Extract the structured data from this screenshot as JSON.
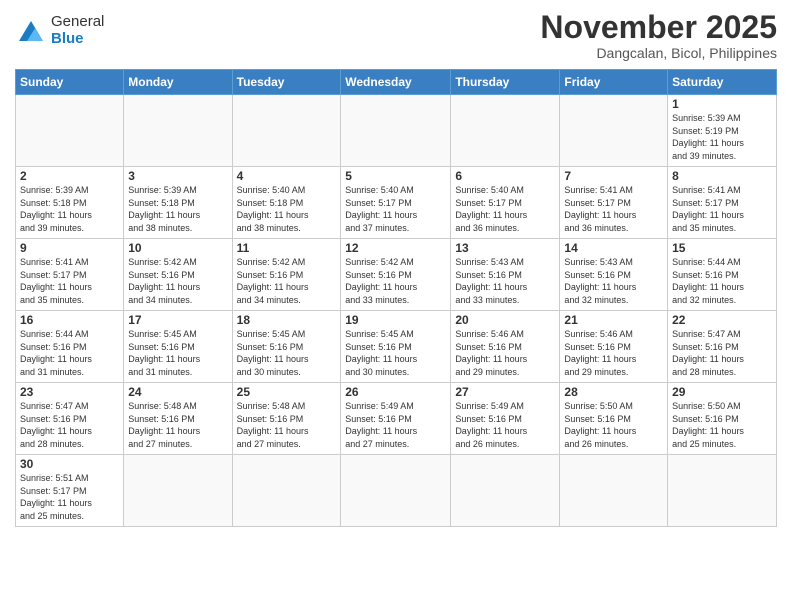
{
  "header": {
    "logo_general": "General",
    "logo_blue": "Blue",
    "month_title": "November 2025",
    "location": "Dangcalan, Bicol, Philippines"
  },
  "weekdays": [
    "Sunday",
    "Monday",
    "Tuesday",
    "Wednesday",
    "Thursday",
    "Friday",
    "Saturday"
  ],
  "days": [
    {
      "date": "",
      "info": ""
    },
    {
      "date": "",
      "info": ""
    },
    {
      "date": "",
      "info": ""
    },
    {
      "date": "",
      "info": ""
    },
    {
      "date": "",
      "info": ""
    },
    {
      "date": "",
      "info": ""
    },
    {
      "date": "1",
      "info": "Sunrise: 5:39 AM\nSunset: 5:19 PM\nDaylight: 11 hours\nand 39 minutes."
    },
    {
      "date": "2",
      "info": "Sunrise: 5:39 AM\nSunset: 5:18 PM\nDaylight: 11 hours\nand 39 minutes."
    },
    {
      "date": "3",
      "info": "Sunrise: 5:39 AM\nSunset: 5:18 PM\nDaylight: 11 hours\nand 38 minutes."
    },
    {
      "date": "4",
      "info": "Sunrise: 5:40 AM\nSunset: 5:18 PM\nDaylight: 11 hours\nand 38 minutes."
    },
    {
      "date": "5",
      "info": "Sunrise: 5:40 AM\nSunset: 5:17 PM\nDaylight: 11 hours\nand 37 minutes."
    },
    {
      "date": "6",
      "info": "Sunrise: 5:40 AM\nSunset: 5:17 PM\nDaylight: 11 hours\nand 36 minutes."
    },
    {
      "date": "7",
      "info": "Sunrise: 5:41 AM\nSunset: 5:17 PM\nDaylight: 11 hours\nand 36 minutes."
    },
    {
      "date": "8",
      "info": "Sunrise: 5:41 AM\nSunset: 5:17 PM\nDaylight: 11 hours\nand 35 minutes."
    },
    {
      "date": "9",
      "info": "Sunrise: 5:41 AM\nSunset: 5:17 PM\nDaylight: 11 hours\nand 35 minutes."
    },
    {
      "date": "10",
      "info": "Sunrise: 5:42 AM\nSunset: 5:16 PM\nDaylight: 11 hours\nand 34 minutes."
    },
    {
      "date": "11",
      "info": "Sunrise: 5:42 AM\nSunset: 5:16 PM\nDaylight: 11 hours\nand 34 minutes."
    },
    {
      "date": "12",
      "info": "Sunrise: 5:42 AM\nSunset: 5:16 PM\nDaylight: 11 hours\nand 33 minutes."
    },
    {
      "date": "13",
      "info": "Sunrise: 5:43 AM\nSunset: 5:16 PM\nDaylight: 11 hours\nand 33 minutes."
    },
    {
      "date": "14",
      "info": "Sunrise: 5:43 AM\nSunset: 5:16 PM\nDaylight: 11 hours\nand 32 minutes."
    },
    {
      "date": "15",
      "info": "Sunrise: 5:44 AM\nSunset: 5:16 PM\nDaylight: 11 hours\nand 32 minutes."
    },
    {
      "date": "16",
      "info": "Sunrise: 5:44 AM\nSunset: 5:16 PM\nDaylight: 11 hours\nand 31 minutes."
    },
    {
      "date": "17",
      "info": "Sunrise: 5:45 AM\nSunset: 5:16 PM\nDaylight: 11 hours\nand 31 minutes."
    },
    {
      "date": "18",
      "info": "Sunrise: 5:45 AM\nSunset: 5:16 PM\nDaylight: 11 hours\nand 30 minutes."
    },
    {
      "date": "19",
      "info": "Sunrise: 5:45 AM\nSunset: 5:16 PM\nDaylight: 11 hours\nand 30 minutes."
    },
    {
      "date": "20",
      "info": "Sunrise: 5:46 AM\nSunset: 5:16 PM\nDaylight: 11 hours\nand 29 minutes."
    },
    {
      "date": "21",
      "info": "Sunrise: 5:46 AM\nSunset: 5:16 PM\nDaylight: 11 hours\nand 29 minutes."
    },
    {
      "date": "22",
      "info": "Sunrise: 5:47 AM\nSunset: 5:16 PM\nDaylight: 11 hours\nand 28 minutes."
    },
    {
      "date": "23",
      "info": "Sunrise: 5:47 AM\nSunset: 5:16 PM\nDaylight: 11 hours\nand 28 minutes."
    },
    {
      "date": "24",
      "info": "Sunrise: 5:48 AM\nSunset: 5:16 PM\nDaylight: 11 hours\nand 27 minutes."
    },
    {
      "date": "25",
      "info": "Sunrise: 5:48 AM\nSunset: 5:16 PM\nDaylight: 11 hours\nand 27 minutes."
    },
    {
      "date": "26",
      "info": "Sunrise: 5:49 AM\nSunset: 5:16 PM\nDaylight: 11 hours\nand 27 minutes."
    },
    {
      "date": "27",
      "info": "Sunrise: 5:49 AM\nSunset: 5:16 PM\nDaylight: 11 hours\nand 26 minutes."
    },
    {
      "date": "28",
      "info": "Sunrise: 5:50 AM\nSunset: 5:16 PM\nDaylight: 11 hours\nand 26 minutes."
    },
    {
      "date": "29",
      "info": "Sunrise: 5:50 AM\nSunset: 5:16 PM\nDaylight: 11 hours\nand 25 minutes."
    },
    {
      "date": "30",
      "info": "Sunrise: 5:51 AM\nSunset: 5:17 PM\nDaylight: 11 hours\nand 25 minutes."
    },
    {
      "date": "",
      "info": ""
    },
    {
      "date": "",
      "info": ""
    },
    {
      "date": "",
      "info": ""
    },
    {
      "date": "",
      "info": ""
    },
    {
      "date": "",
      "info": ""
    },
    {
      "date": "",
      "info": ""
    }
  ]
}
